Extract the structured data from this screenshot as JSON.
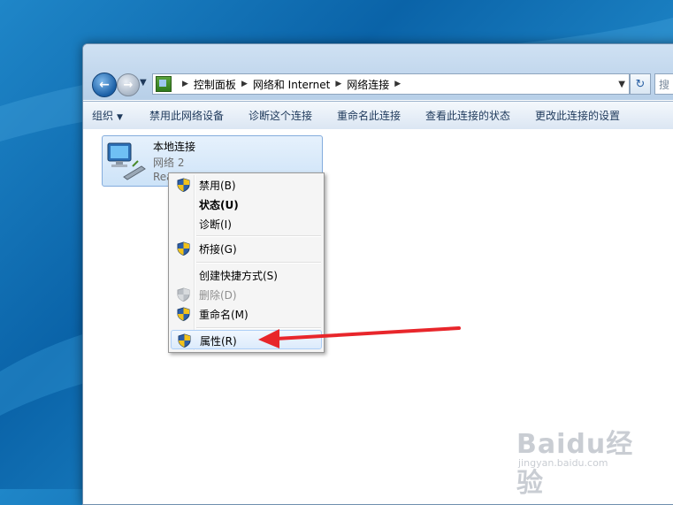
{
  "address": {
    "crumbs": [
      "控制面板",
      "网络和 Internet",
      "网络连接"
    ]
  },
  "search": {
    "placeholder": "搜"
  },
  "toolbar": {
    "organize": "组织",
    "items": [
      "禁用此网络设备",
      "诊断这个连接",
      "重命名此连接",
      "查看此连接的状态",
      "更改此连接的设置"
    ]
  },
  "connection": {
    "name": "本地连接",
    "network": "网络  2",
    "device": "Rea"
  },
  "context_menu": {
    "items": [
      {
        "label": "禁用(B)",
        "icon": "uac-shield-icon",
        "state": "normal"
      },
      {
        "label": "状态(U)",
        "icon": "",
        "state": "default"
      },
      {
        "label": "诊断(I)",
        "icon": "",
        "state": "normal"
      },
      {
        "label": "桥接(G)",
        "icon": "uac-shield-icon",
        "state": "normal"
      },
      {
        "label": "创建快捷方式(S)",
        "icon": "",
        "state": "normal"
      },
      {
        "label": "删除(D)",
        "icon": "uac-shield-icon",
        "state": "disabled"
      },
      {
        "label": "重命名(M)",
        "icon": "uac-shield-icon",
        "state": "normal"
      },
      {
        "label": "属性(R)",
        "icon": "uac-shield-icon",
        "state": "highlighted"
      }
    ]
  },
  "annotation": {
    "arrow_color": "#e8262b",
    "points_to": "属性(R)"
  },
  "watermark": {
    "logo": "Baidu经验",
    "url": "jingyan.baidu.com"
  }
}
